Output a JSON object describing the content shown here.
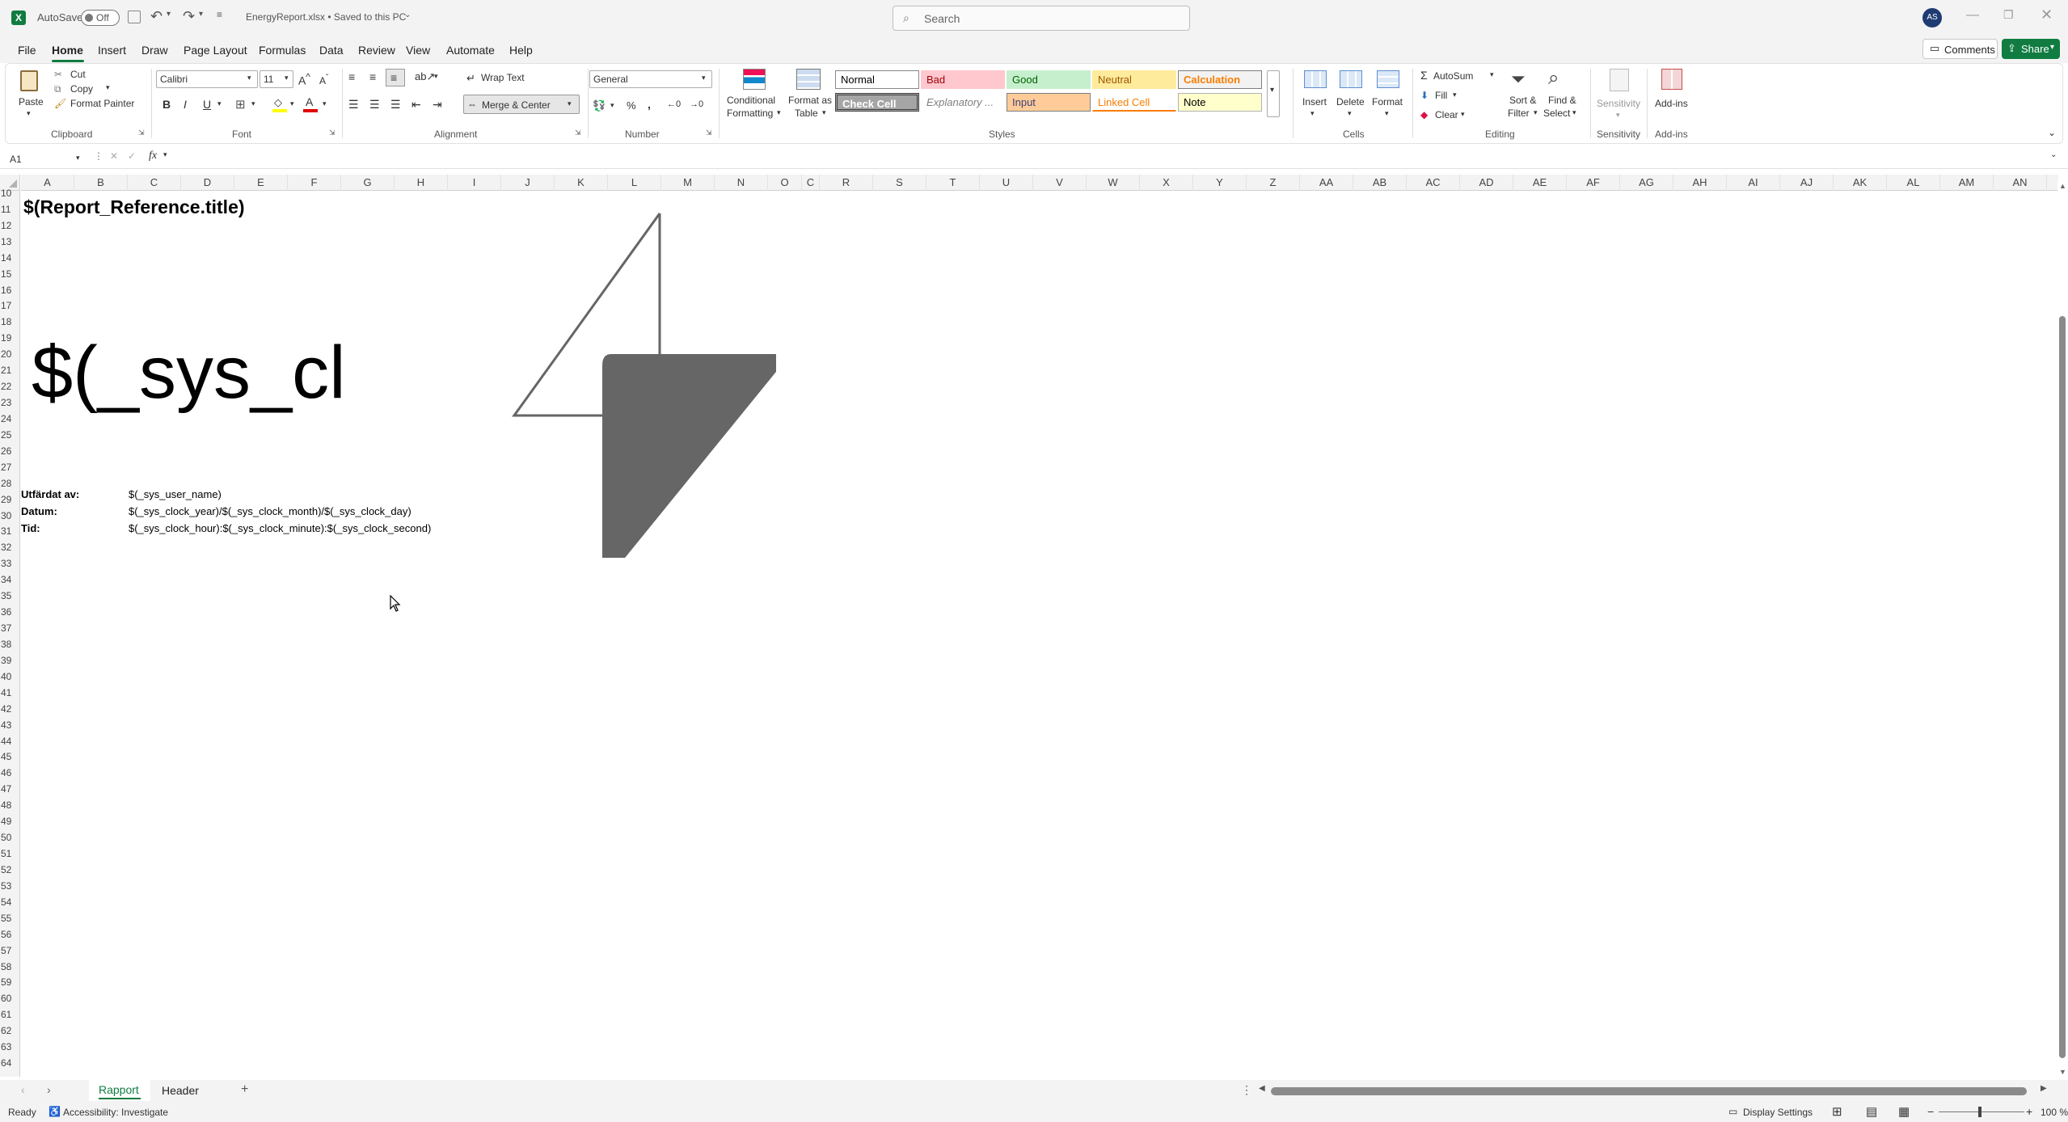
{
  "titlebar": {
    "autosave_label": "AutoSave",
    "autosave_state": "Off",
    "filename": "EnergyReport.xlsx • Saved to this PC",
    "search_placeholder": "Search",
    "avatar_initials": "AS"
  },
  "menu": [
    "File",
    "Home",
    "Insert",
    "Draw",
    "Page Layout",
    "Formulas",
    "Data",
    "Review",
    "View",
    "Automate",
    "Help"
  ],
  "comments_label": "Comments",
  "share_label": "Share",
  "ribbon": {
    "clipboard": {
      "paste": "Paste",
      "cut": "Cut",
      "copy": "Copy",
      "format_painter": "Format Painter",
      "group": "Clipboard"
    },
    "font": {
      "name": "Calibri",
      "size": "11",
      "group": "Font",
      "bold": "B",
      "italic": "I",
      "underline": "U"
    },
    "alignment": {
      "wrap": "Wrap Text",
      "merge": "Merge & Center",
      "group": "Alignment"
    },
    "number": {
      "format": "General",
      "group": "Number"
    },
    "styles": {
      "conditional_1": "Conditional",
      "conditional_2": "Formatting",
      "format_table_1": "Format as",
      "format_table_2": "Table",
      "cells": [
        {
          "label": "Normal",
          "bg": "#ffffff",
          "fg": "#000000",
          "border": "#888888"
        },
        {
          "label": "Bad",
          "bg": "#ffc7ce",
          "fg": "#9c0006",
          "border": "#ffc7ce"
        },
        {
          "label": "Good",
          "bg": "#c6efce",
          "fg": "#006100",
          "border": "#c6efce"
        },
        {
          "label": "Neutral",
          "bg": "#ffeb9c",
          "fg": "#9c5700",
          "border": "#ffeb9c"
        },
        {
          "label": "Calculation",
          "bg": "#f2f2f2",
          "fg": "#fa7d00",
          "border": "#7f7f7f"
        },
        {
          "label": "Check Cell",
          "bg": "#a5a5a5",
          "fg": "#ffffff",
          "border": "#3f3f3f"
        },
        {
          "label": "Explanatory ...",
          "bg": "#ffffff",
          "fg": "#7f7f7f",
          "border": "#ffffff"
        },
        {
          "label": "Input",
          "bg": "#ffcc99",
          "fg": "#3f3f76",
          "border": "#7f7f7f"
        },
        {
          "label": "Linked Cell",
          "bg": "#ffffff",
          "fg": "#fa7d00",
          "border": "#ffffff"
        },
        {
          "label": "Note",
          "bg": "#ffffcc",
          "fg": "#000000",
          "border": "#b2b2b2"
        }
      ],
      "group": "Styles"
    },
    "cells": {
      "insert": "Insert",
      "delete": "Delete",
      "format": "Format",
      "group": "Cells"
    },
    "editing": {
      "autosum": "AutoSum",
      "fill": "Fill",
      "clear": "Clear",
      "sort_1": "Sort &",
      "sort_2": "Filter",
      "find_1": "Find &",
      "find_2": "Select",
      "group": "Editing"
    },
    "sensitivity": {
      "label": "Sensitivity",
      "group": "Sensitivity"
    },
    "addins": {
      "label": "Add-ins",
      "group": "Add-ins"
    }
  },
  "formula": {
    "namebox": "A1",
    "fx": "fx",
    "content": ""
  },
  "columns": [
    "A",
    "B",
    "C",
    "D",
    "E",
    "F",
    "G",
    "H",
    "I",
    "J",
    "K",
    "L",
    "M",
    "N",
    "O",
    "C",
    "R",
    "S",
    "T",
    "U",
    "V",
    "W",
    "X",
    "Y",
    "Z",
    "AA",
    "AB",
    "AC",
    "AD",
    "AE",
    "AF",
    "AG",
    "AH",
    "AI",
    "AJ",
    "AK",
    "AL",
    "AM",
    "AN"
  ],
  "rows_start": 10,
  "rows_end": 64,
  "sheet": {
    "title": "$(Report_Reference.title)",
    "big_text": "$(_sys_clo",
    "issued_label": "Utfärdat av:",
    "issued_value": "$(_sys_user_name)",
    "date_label": "Datum:",
    "date_value": "$(_sys_clock_year)/$(_sys_clock_month)/$(_sys_clock_day)",
    "time_label": "Tid:",
    "time_value": "$(_sys_clock_hour):$(_sys_clock_minute):$(_sys_clock_second)"
  },
  "tabs": [
    "Rapport",
    "Header"
  ],
  "status": {
    "ready": "Ready",
    "accessibility": "Accessibility: Investigate",
    "display_settings": "Display Settings",
    "zoom": "100 %"
  },
  "colors": {
    "accent": "#107c41",
    "share_bg": "#107c41"
  }
}
